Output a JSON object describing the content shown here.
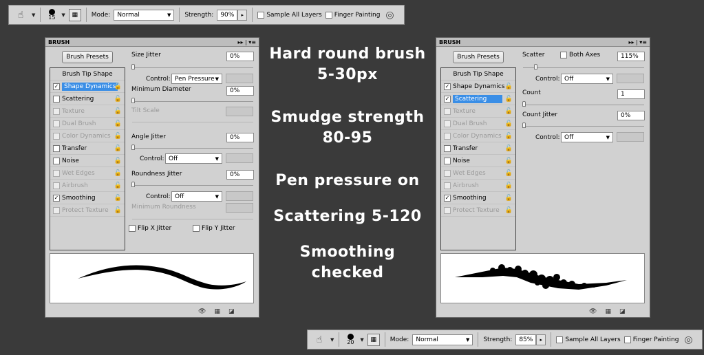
{
  "top_toolbar": {
    "brush_size": "15",
    "mode_label": "Mode:",
    "mode_value": "Normal",
    "strength_label": "Strength:",
    "strength_value": "90%",
    "sample_all_layers": "Sample All Layers",
    "finger_painting": "Finger Painting"
  },
  "bottom_toolbar": {
    "brush_size": "20",
    "mode_label": "Mode:",
    "mode_value": "Normal",
    "strength_label": "Strength:",
    "strength_value": "85%",
    "sample_all_layers": "Sample All Layers",
    "finger_painting": "Finger Painting"
  },
  "left_panel": {
    "title": "BRUSH",
    "presets_button": "Brush Presets",
    "items": [
      {
        "label": "Brush Tip Shape"
      },
      {
        "label": "Shape Dynamics"
      },
      {
        "label": "Scattering"
      },
      {
        "label": "Texture"
      },
      {
        "label": "Dual Brush"
      },
      {
        "label": "Color Dynamics"
      },
      {
        "label": "Transfer"
      },
      {
        "label": "Noise"
      },
      {
        "label": "Wet Edges"
      },
      {
        "label": "Airbrush"
      },
      {
        "label": "Smoothing"
      },
      {
        "label": "Protect Texture"
      }
    ],
    "size_jitter_label": "Size Jitter",
    "size_jitter_value": "0%",
    "control_label": "Control:",
    "control1_value": "Pen Pressure",
    "min_diameter_label": "Minimum Diameter",
    "min_diameter_value": "0%",
    "tilt_scale_label": "Tilt Scale",
    "angle_jitter_label": "Angle Jitter",
    "angle_jitter_value": "0%",
    "control2_value": "Off",
    "roundness_jitter_label": "Roundness Jitter",
    "roundness_jitter_value": "0%",
    "control3_value": "Off",
    "min_roundness_label": "Minimum Roundness",
    "flip_x": "Flip X Jitter",
    "flip_y": "Flip Y Jitter"
  },
  "right_panel": {
    "title": "BRUSH",
    "presets_button": "Brush Presets",
    "items": [
      {
        "label": "Brush Tip Shape"
      },
      {
        "label": "Shape Dynamics"
      },
      {
        "label": "Scattering"
      },
      {
        "label": "Texture"
      },
      {
        "label": "Dual Brush"
      },
      {
        "label": "Color Dynamics"
      },
      {
        "label": "Transfer"
      },
      {
        "label": "Noise"
      },
      {
        "label": "Wet Edges"
      },
      {
        "label": "Airbrush"
      },
      {
        "label": "Smoothing"
      },
      {
        "label": "Protect Texture"
      }
    ],
    "scatter_label": "Scatter",
    "both_axes_label": "Both Axes",
    "scatter_value": "115%",
    "control_label": "Control:",
    "control1_value": "Off",
    "count_label": "Count",
    "count_value": "1",
    "count_jitter_label": "Count Jitter",
    "count_jitter_value": "0%",
    "control2_value": "Off"
  },
  "notes": {
    "line1": "Hard round brush",
    "line2": "5-30px",
    "line3": "Smudge strength",
    "line4": "80-95",
    "line5": "Pen pressure on",
    "line6": "Scattering 5-120",
    "line7": "Smoothing",
    "line8": "checked"
  },
  "colors": {
    "background": "#3a3a3a",
    "panel": "#d1d1d1",
    "selection": "#3a8ee6"
  }
}
